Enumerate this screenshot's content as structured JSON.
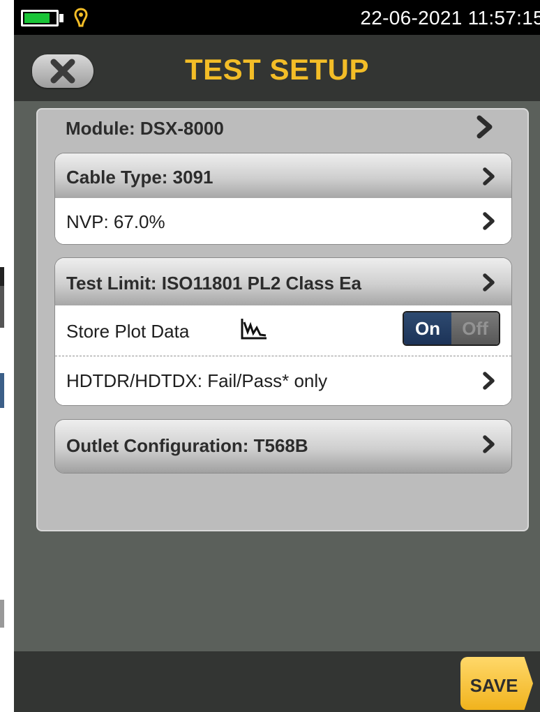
{
  "status": {
    "datetime": "22-06-2021 11:57:15"
  },
  "header": {
    "title": "TEST SETUP",
    "close_icon": "close-icon"
  },
  "module": {
    "label": "Module: DSX-8000"
  },
  "cable": {
    "label": "Cable Type: 3091",
    "nvp": "NVP: 67.0%"
  },
  "limit": {
    "label": "Test Limit: ISO11801 PL2 Class Ea",
    "store_plot": "Store Plot Data",
    "toggle_on": "On",
    "toggle_off": "Off",
    "hdtdr": "HDTDR/HDTDX: Fail/Pass* only"
  },
  "outlet": {
    "label": "Outlet Configuration: T568B"
  },
  "footer": {
    "save_label": "SAVE"
  },
  "colors": {
    "accent": "#f3bd27",
    "battery": "#19c437",
    "toggle_on": "#1c3358"
  }
}
